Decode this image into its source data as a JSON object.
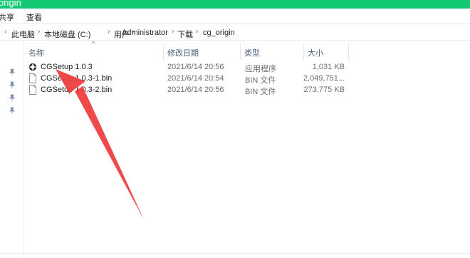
{
  "window": {
    "title": "origin"
  },
  "ribbon": {
    "tabs": [
      "共享",
      "查看"
    ]
  },
  "address_bar": {
    "segments": [
      "此电脑",
      "本地磁盘 (C:)",
      "用户",
      "Administrator",
      "下载",
      "cg_origin"
    ]
  },
  "columns": {
    "name": "名称",
    "date": "修改日期",
    "type": "类型",
    "size": "大小"
  },
  "files": [
    {
      "name": "CGSetup 1.0.3",
      "date": "2021/6/14 20:56",
      "type": "应用程序",
      "size": "1,031 KB",
      "icon": "app-icon"
    },
    {
      "name": "CGSetup 1.0.3-1.bin",
      "date": "2021/6/14 20:54",
      "type": "BIN 文件",
      "size": "2,049,751...",
      "icon": "file-icon"
    },
    {
      "name": "CGSetup 1.0.3-2.bin",
      "date": "2021/6/14 20:56",
      "type": "BIN 文件",
      "size": "273,775 KB",
      "icon": "file-icon"
    }
  ],
  "colors": {
    "title_bar": "#13c872",
    "annotation_arrow": "#ee3f3f"
  }
}
